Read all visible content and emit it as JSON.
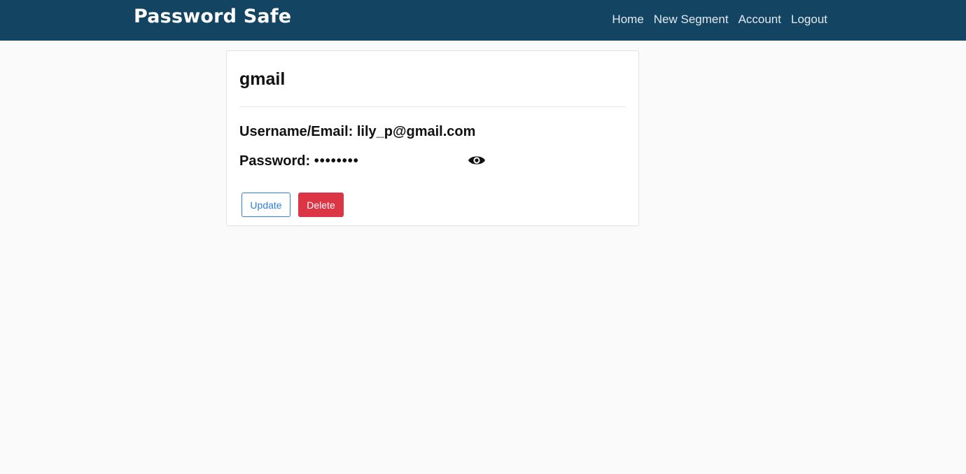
{
  "navbar": {
    "brand": "Password Safe",
    "links": [
      "Home",
      "New Segment",
      "Account",
      "Logout"
    ]
  },
  "card": {
    "title": "gmail",
    "username_label": "Username/Email:",
    "username_value": "lily_p@gmail.com",
    "password_label": "Password:",
    "password_value": "••••••••",
    "reveal_icon": "eye-icon",
    "update_label": "Update",
    "delete_label": "Delete"
  },
  "colors": {
    "navbar_bg": "#134563",
    "primary": "#2f7fd6",
    "danger": "#dc3545",
    "page_bg": "#fafafa"
  }
}
